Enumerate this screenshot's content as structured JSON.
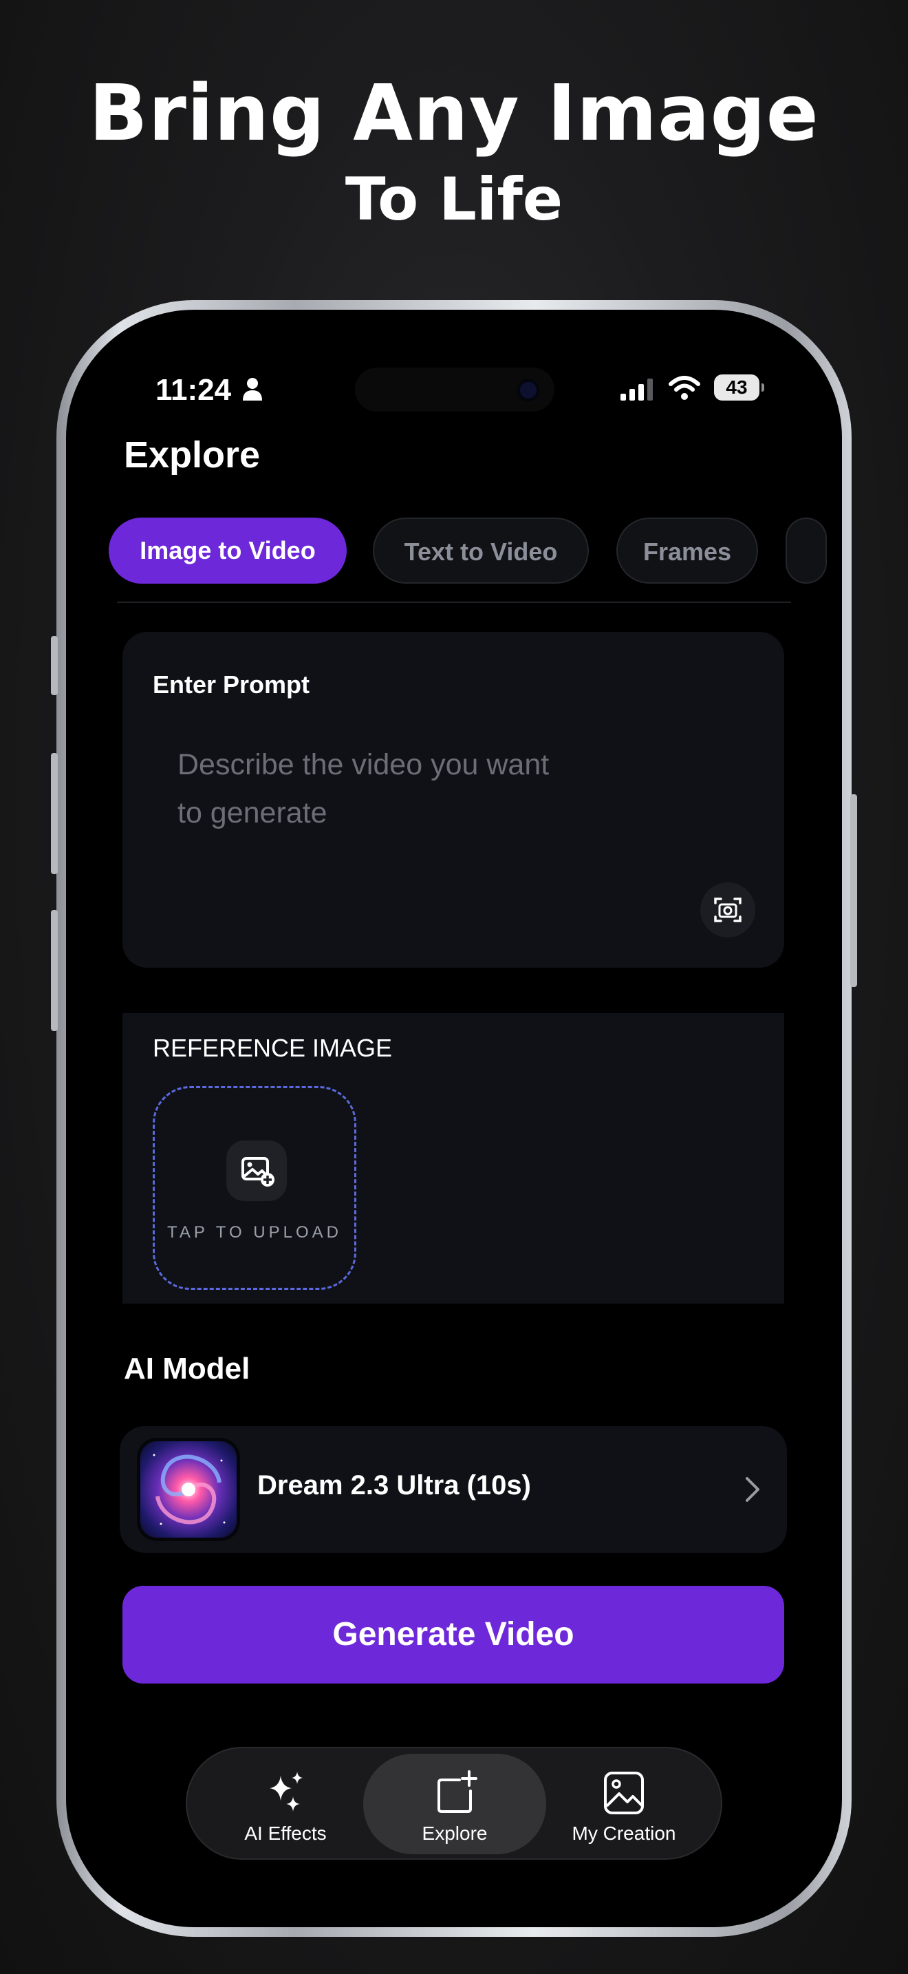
{
  "promo": {
    "line1": "Bring Any Image",
    "line2": "To Life"
  },
  "status_bar": {
    "time": "11:24",
    "battery": "43"
  },
  "page": {
    "title": "Explore"
  },
  "tabs": [
    {
      "label": "Image to Video",
      "active": true
    },
    {
      "label": "Text to Video",
      "active": false
    },
    {
      "label": "Frames",
      "active": false
    }
  ],
  "prompt": {
    "label": "Enter Prompt",
    "placeholder_line1": "Describe the video you want",
    "placeholder_line2": "to generate"
  },
  "reference": {
    "label": "REFERENCE IMAGE",
    "upload_text": "TAP TO UPLOAD"
  },
  "ai_model": {
    "section_title": "AI Model",
    "name": "Dream 2.3 Ultra (10s)"
  },
  "generate_button": "Generate Video",
  "bottom_nav": [
    {
      "label": "AI Effects",
      "icon": "sparkles-icon",
      "active": false
    },
    {
      "label": "Explore",
      "icon": "add-square-icon",
      "active": true
    },
    {
      "label": "My Creation",
      "icon": "image-icon",
      "active": false
    }
  ],
  "colors": {
    "accent": "#6d28d9",
    "card": "#0f1116",
    "dashed_border": "#5b6ae0"
  }
}
